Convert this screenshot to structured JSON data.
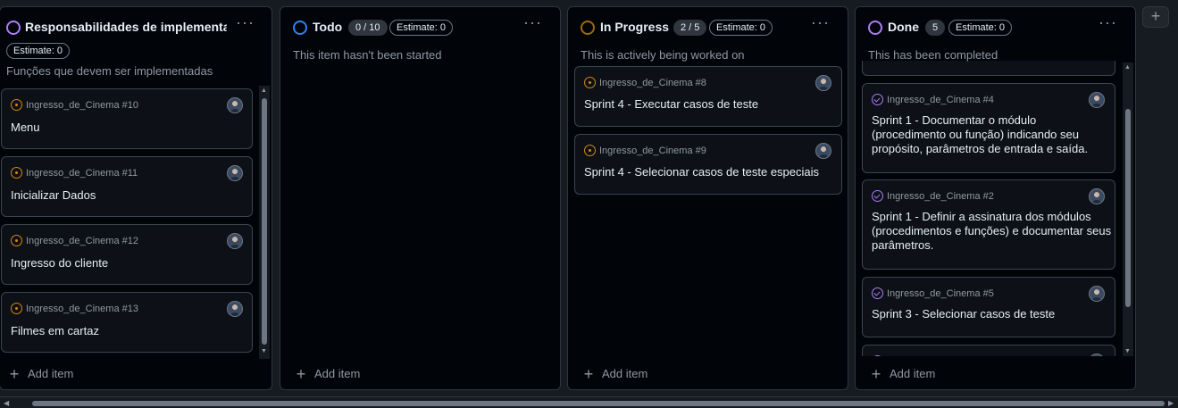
{
  "colors": {
    "orange": "#d18616",
    "purple": "#ab7df8",
    "blue": "#2f81f7",
    "bg": "#010409"
  },
  "common": {
    "estimate_label": "Estimate: 0",
    "add_item": "Add item",
    "dots": "···",
    "plus": "+"
  },
  "columns": {
    "backlog": {
      "title": "Responsabilidades de implementação",
      "estimate": "Estimate: 0",
      "description": "Funções que devem ser implementadas",
      "cards": [
        {
          "meta": "Ingresso_de_Cinema #10",
          "title": "Menu"
        },
        {
          "meta": "Ingresso_de_Cinema #11",
          "title": "Inicializar Dados"
        },
        {
          "meta": "Ingresso_de_Cinema #12",
          "title": "Ingresso do cliente"
        },
        {
          "meta": "Ingresso_de_Cinema #13",
          "title": "Filmes em cartaz"
        }
      ]
    },
    "todo": {
      "title": "Todo",
      "count": "0 / 10",
      "estimate": "Estimate: 0",
      "description": "This item hasn't been started",
      "cards": []
    },
    "in_progress": {
      "title": "In Progress",
      "count": "2 / 5",
      "estimate": "Estimate: 0",
      "description": "This is actively being worked on",
      "cards": [
        {
          "meta": "Ingresso_de_Cinema #8",
          "title": "Sprint 4 - Executar casos de teste"
        },
        {
          "meta": "Ingresso_de_Cinema #9",
          "title": "Sprint 4 - Selecionar casos de teste especiais"
        }
      ]
    },
    "done": {
      "title": "Done",
      "count": "5",
      "estimate": "Estimate: 0",
      "description": "This has been completed",
      "cards": [
        {
          "meta": "Ingresso_de_Cinema #4",
          "title_lines": [
            "Sprint 1 - Documentar o módulo",
            "(procedimento ou função) indicando seu",
            "propósito, parâmetros de entrada e saída."
          ]
        },
        {
          "meta": "Ingresso_de_Cinema #2",
          "title_lines": [
            "Sprint 1 - Definir a assinatura dos módulos",
            "(procedimentos e funções) e documentar seus",
            "parâmetros."
          ]
        },
        {
          "meta": "Ingresso_de_Cinema #5",
          "title_lines": [
            "Sprint 3 - Selecionar casos de teste"
          ]
        }
      ]
    }
  }
}
